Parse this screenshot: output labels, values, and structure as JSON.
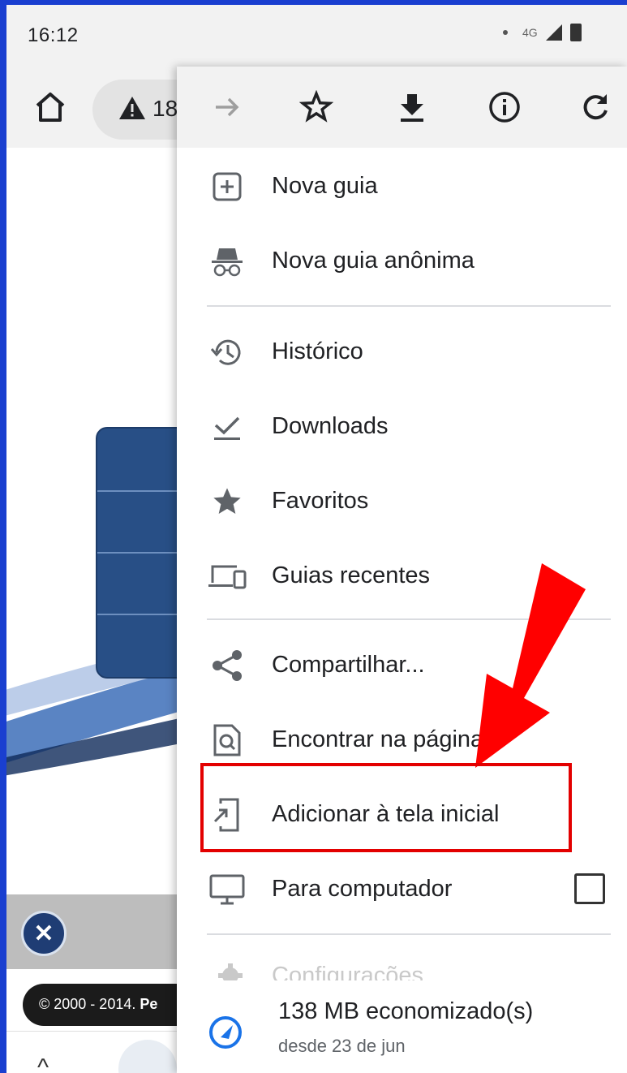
{
  "status_bar": {
    "time": "16:12",
    "network": "4G",
    "icons": [
      "dot-icon",
      "signal-icon",
      "battery-icon"
    ]
  },
  "toolbar": {
    "home_icon": "home-icon",
    "url_warning_icon": "warning-triangle-icon",
    "url_fragment": "18"
  },
  "menu": {
    "icon_bar": [
      {
        "name": "forward-arrow-icon"
      },
      {
        "name": "star-outline-icon"
      },
      {
        "name": "download-icon"
      },
      {
        "name": "info-icon"
      },
      {
        "name": "reload-icon"
      }
    ],
    "items": [
      {
        "label": "Nova guia",
        "icon": "new-tab-icon"
      },
      {
        "label": "Nova guia anônima",
        "icon": "incognito-icon"
      },
      {
        "label": "Histórico",
        "icon": "history-icon"
      },
      {
        "label": "Downloads",
        "icon": "downloads-check-icon"
      },
      {
        "label": "Favoritos",
        "icon": "star-filled-icon"
      },
      {
        "label": "Guias recentes",
        "icon": "devices-icon"
      },
      {
        "label": "Compartilhar...",
        "icon": "share-icon"
      },
      {
        "label": "Encontrar na página",
        "icon": "find-in-page-icon"
      },
      {
        "label": "Adicionar à tela inicial",
        "icon": "add-to-home-icon"
      },
      {
        "label": "Para computador",
        "icon": "desktop-icon",
        "checked": false
      },
      {
        "label": "Configurações",
        "icon": "gear-icon"
      }
    ],
    "data_saver": {
      "title": "138 MB economizado(s)",
      "subtitle": "desde 23 de jun",
      "icon": "data-saver-gauge-icon"
    }
  },
  "page": {
    "copyright_prefix": "© 2000 - 2014.",
    "copyright_bold": "Pe",
    "close_icon": "close-circle-icon"
  },
  "annotation": {
    "highlight_color": "#e30000",
    "arrow_color": "#ff0000"
  }
}
